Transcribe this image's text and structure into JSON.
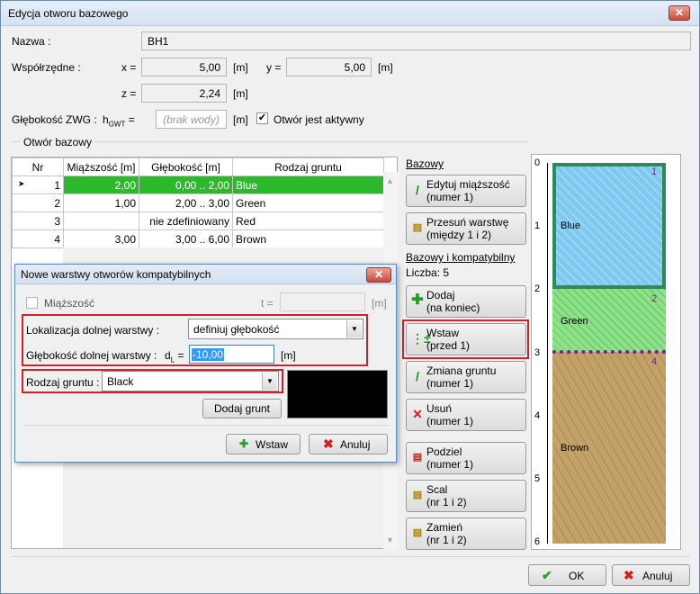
{
  "window": {
    "title": "Edycja otworu bazowego",
    "close": "✕"
  },
  "form": {
    "name_label": "Nazwa :",
    "name_value": "BH1",
    "coords_label": "Współrzędne :",
    "x_label": "x =",
    "x_value": "5,00",
    "x_unit": "[m]",
    "y_label": "y =",
    "y_value": "5,00",
    "y_unit": "[m]",
    "z_label": "z =",
    "z_value": "2,24",
    "z_unit": "[m]",
    "gwt_label": "Głębokość ZWG :",
    "hgwt_label": "h",
    "hgwt_sub": "GWT",
    "hgwt_eq": "=",
    "hgwt_placeholder": "(brak wody)",
    "hgwt_unit": "[m]",
    "active_label": "Otwór jest aktywny",
    "active_checked": true
  },
  "section": {
    "label": "Otwór bazowy"
  },
  "table": {
    "headers": [
      "Nr",
      "Miąższość [m]",
      "Głębokość [m]",
      "Rodzaj gruntu"
    ],
    "rows": [
      {
        "nr": "1",
        "thickness": "2,00",
        "depth": "0,00 .. 2,00",
        "soil": "Blue",
        "selected": true
      },
      {
        "nr": "2",
        "thickness": "1,00",
        "depth": "2,00 .. 3,00",
        "soil": "Green",
        "selected": false
      },
      {
        "nr": "3",
        "thickness": "",
        "depth": "nie zdefiniowany",
        "soil": "Red",
        "selected": false
      },
      {
        "nr": "4",
        "thickness": "3,00",
        "depth": "3,00 .. 6,00",
        "soil": "Brown",
        "selected": false
      }
    ]
  },
  "dialog": {
    "title": "Nowe warstwy otworów kompatybilnych",
    "thickness_label": "Miąższość",
    "t_label": "t =",
    "t_unit": "[m]",
    "location_label": "Lokalizacja dolnej warstwy :",
    "location_value": "definiuj głębokość",
    "depth_label": "Głębokość dolnej warstwy :",
    "dl_label": "d",
    "dl_sub": "L",
    "dl_eq": "=",
    "dl_value": "-10,00",
    "dl_unit": "[m]",
    "soil_label": "Rodzaj gruntu :",
    "soil_value": "Black",
    "soil_color": "#000000",
    "add_soil": "Dodaj grunt",
    "insert": "Wstaw",
    "cancel": "Anuluj"
  },
  "side": {
    "base_label": "Bazowy",
    "edit_thickness": [
      "Edytuj miąższość",
      "(numer 1)"
    ],
    "move_layers": [
      "Przesuń warstwę",
      "(między 1 i 2)"
    ],
    "compat_label": "Bazowy i kompatybilny",
    "count_label": "Liczba: 5",
    "add": [
      "Dodaj",
      "(na koniec)"
    ],
    "insert": [
      "Wstaw",
      "(przed 1)"
    ],
    "change_soil": [
      "Zmiana gruntu",
      "(numer 1)"
    ],
    "remove": [
      "Usuń",
      "(numer 1)"
    ],
    "split": [
      "Podziel",
      "(numer 1)"
    ],
    "merge": [
      "Scal",
      "(nr 1 i 2)"
    ],
    "swap": [
      "Zamień",
      "(nr 1 i 2)"
    ]
  },
  "profile": {
    "ticks": [
      "0",
      "1",
      "2",
      "3",
      "4",
      "5",
      "6"
    ],
    "layers": [
      {
        "name": "Blue",
        "num": "1",
        "color": "#7fc8f0"
      },
      {
        "name": "Green",
        "num": "2",
        "color": "#8ee08a"
      },
      {
        "name": "Brown",
        "num": "4",
        "color": "#c3a26a"
      }
    ]
  },
  "footer": {
    "ok": "OK",
    "cancel": "Anuluj"
  },
  "colors": {
    "selected_row": "#2db82d",
    "highlight": "#d0202a"
  }
}
